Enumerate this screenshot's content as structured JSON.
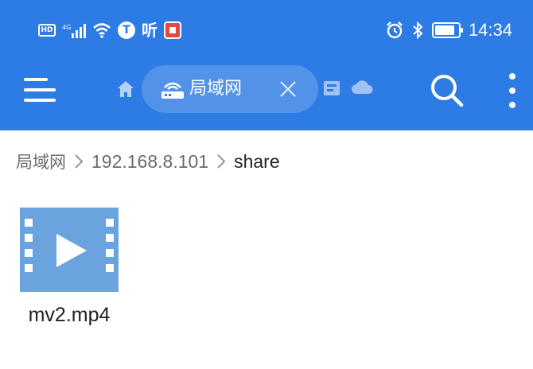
{
  "status_bar": {
    "hd_label": "HD",
    "carrier_glyph": "听",
    "time": "14:34"
  },
  "toolbar": {
    "tab_label": "局域网"
  },
  "breadcrumb": [
    "局域网",
    "192.168.8.101",
    "share"
  ],
  "files": [
    {
      "name": "mv2.mp4",
      "icon": "video-file-icon"
    }
  ],
  "colors": {
    "header_bg": "#2d7be5",
    "video_icon": "#6aa3de"
  }
}
